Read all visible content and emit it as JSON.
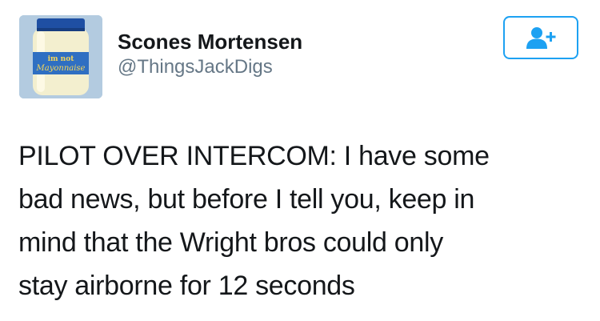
{
  "author": {
    "display_name": "Scones Mortensen",
    "handle": "@ThingsJackDigs",
    "avatar": {
      "label_top": "im not",
      "label_main": "Mayonnaise",
      "background_color": "#a8c4dc",
      "lid_color": "#1f4fa3",
      "label_color": "#2f6fc2"
    }
  },
  "follow_button": {
    "icon": "follow-user-plus-icon",
    "color": "#1da1f2"
  },
  "tweet": {
    "lines": [
      "PILOT OVER INTERCOM: I have some",
      "bad news, but before I tell you, keep in",
      "mind that the Wright bros could only",
      "stay airborne for 12 seconds"
    ]
  }
}
